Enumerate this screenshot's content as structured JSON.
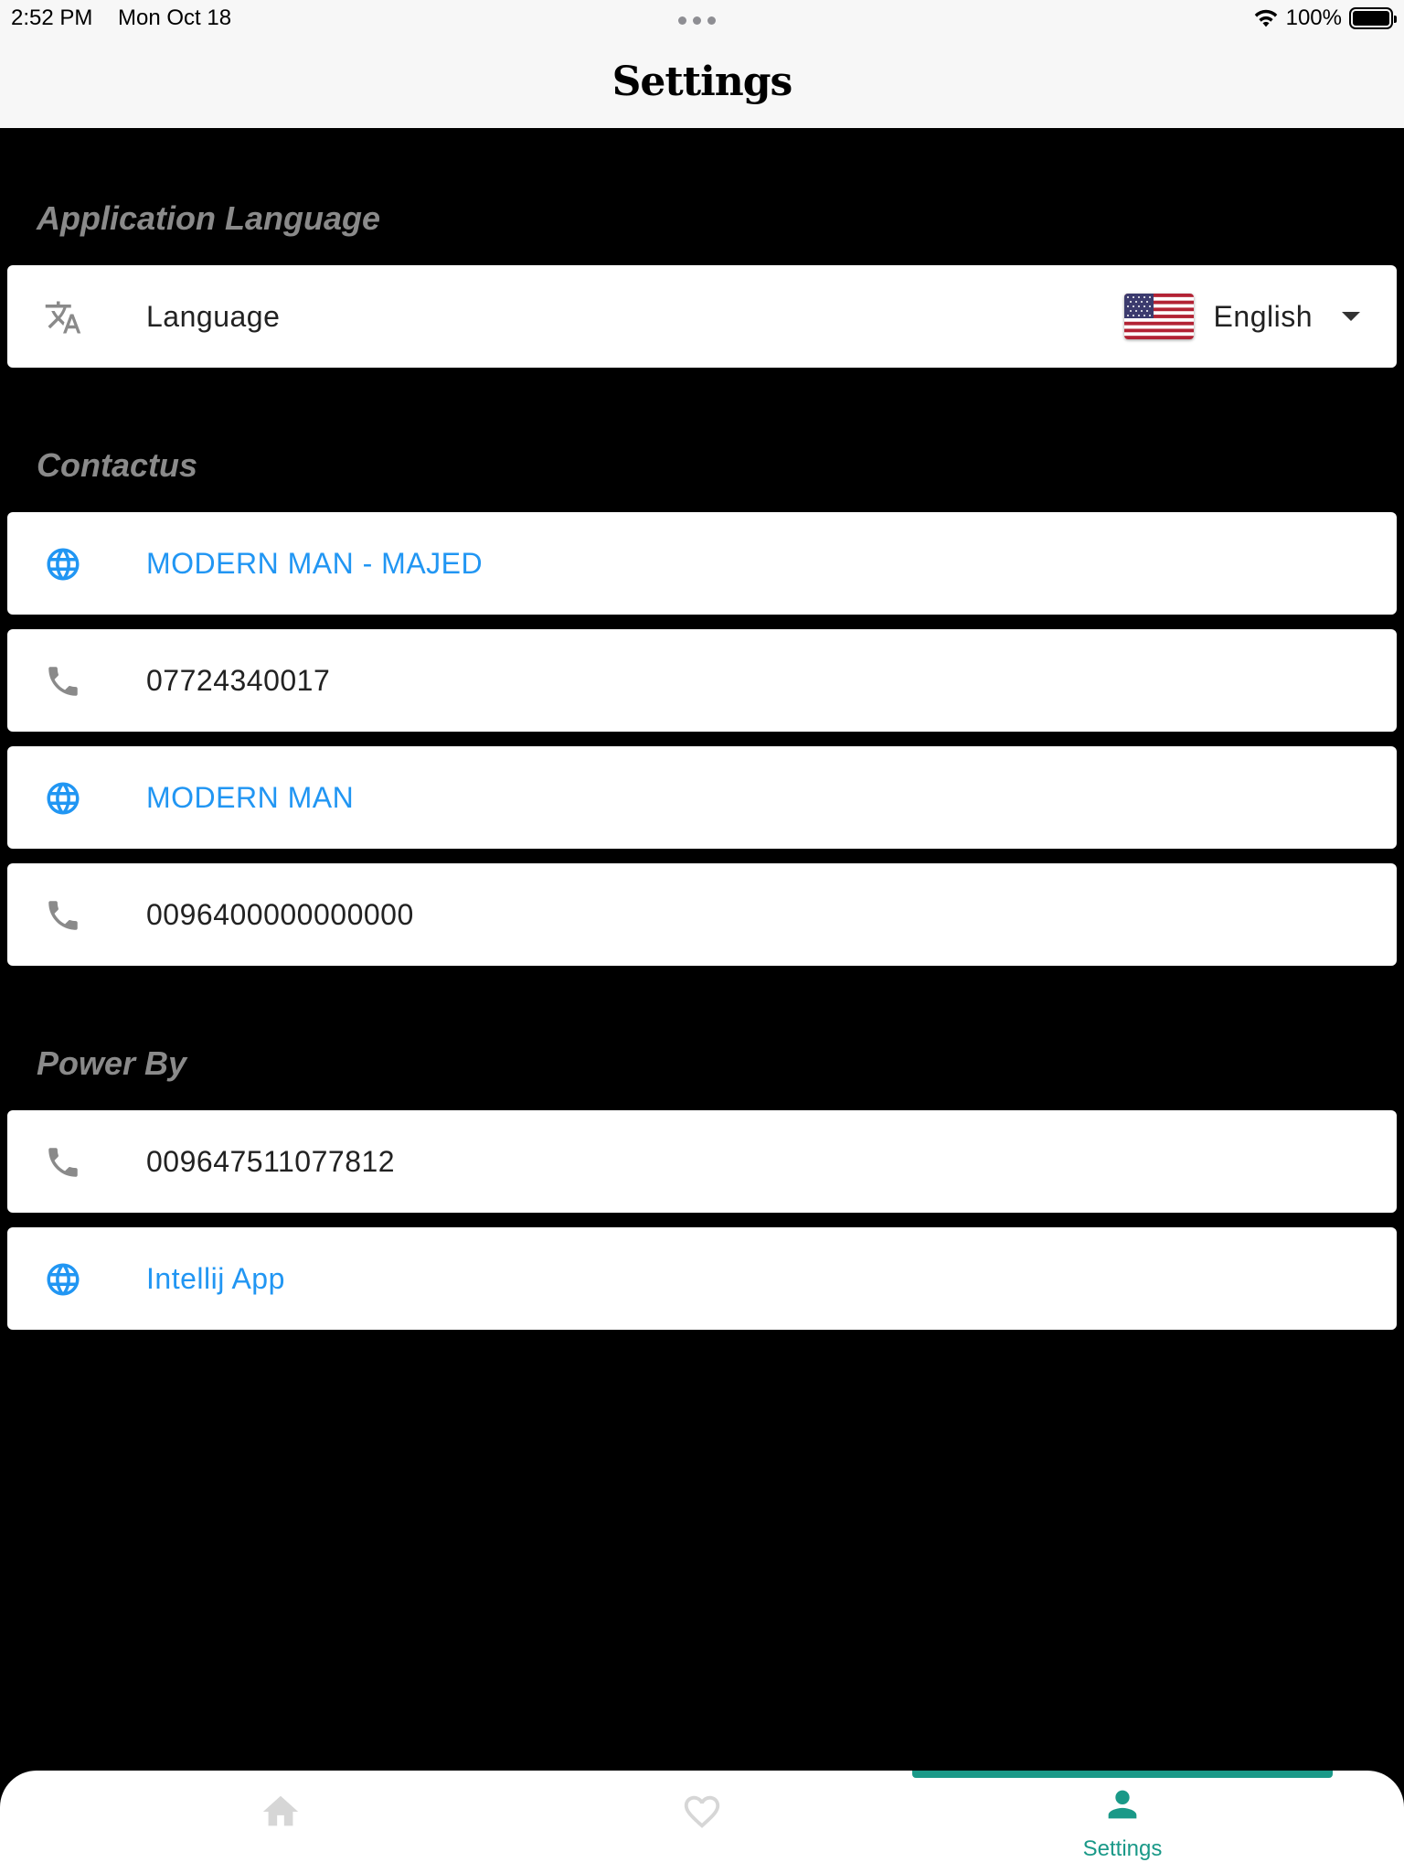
{
  "status_bar": {
    "time": "2:52 PM",
    "date": "Mon Oct 18",
    "battery": "100%"
  },
  "header": {
    "title": "Settings"
  },
  "sections": {
    "language": {
      "title": "Application Language",
      "row_label": "Language",
      "selected_language": "English",
      "flag_icon": "us-flag-icon"
    },
    "contact": {
      "title": "Contactus",
      "items": [
        {
          "icon": "globe-icon",
          "label": "MODERN MAN - MAJED",
          "type": "link"
        },
        {
          "icon": "phone-icon",
          "label": "07724340017",
          "type": "phone"
        },
        {
          "icon": "globe-icon",
          "label": "MODERN MAN",
          "type": "link"
        },
        {
          "icon": "phone-icon",
          "label": "0096400000000000",
          "type": "phone"
        }
      ]
    },
    "power_by": {
      "title": "Power By",
      "items": [
        {
          "icon": "phone-icon",
          "label": "009647511077812",
          "type": "phone"
        },
        {
          "icon": "globe-icon",
          "label": "Intellij App",
          "type": "link"
        }
      ]
    }
  },
  "bottom_nav": {
    "tabs": [
      {
        "icon": "home-icon",
        "label": ""
      },
      {
        "icon": "heart-icon",
        "label": ""
      },
      {
        "icon": "person-icon",
        "label": "Settings",
        "active": true
      }
    ]
  },
  "colors": {
    "link": "#2196f3",
    "accent": "#1a9988",
    "section_header": "#8a8a8a",
    "background": "#000000"
  }
}
